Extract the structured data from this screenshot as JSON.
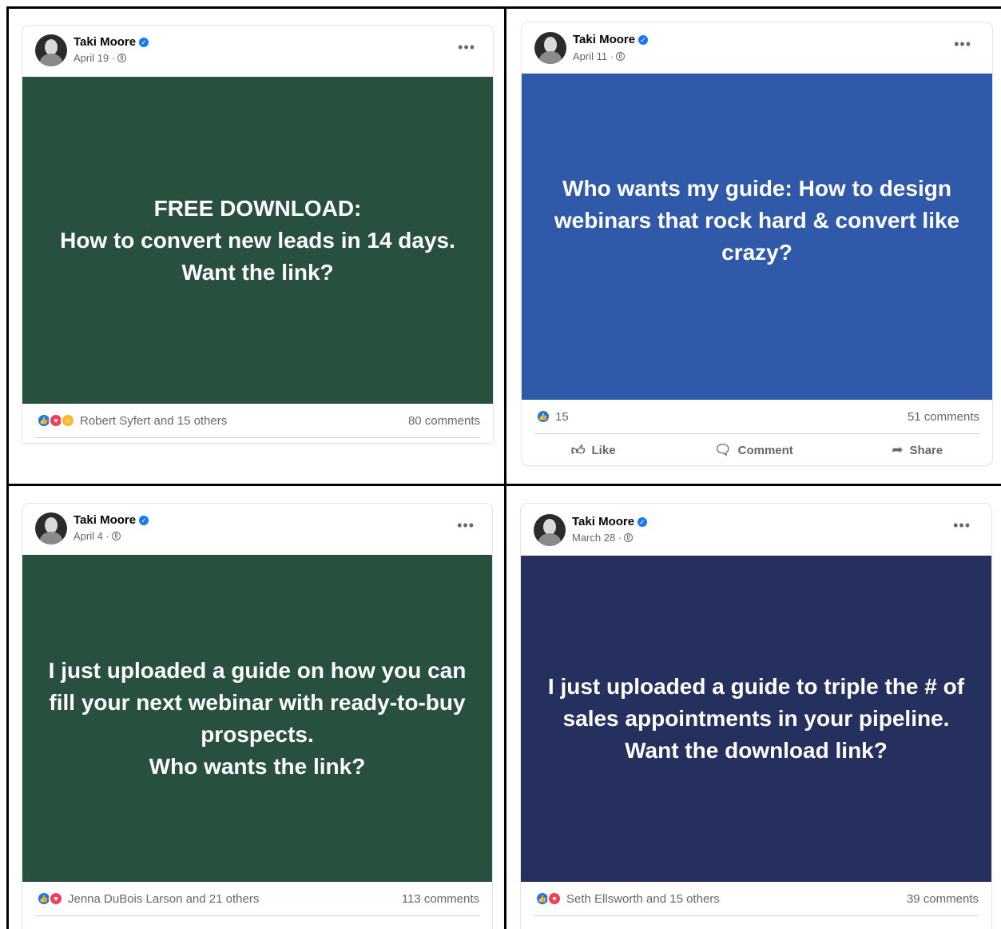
{
  "posts": [
    {
      "author": "Taki Moore",
      "date": "April 19 ·",
      "banner_text": "FREE DOWNLOAD:\nHow to convert new leads in 14 days.\nWant the link?",
      "banner_color": "#27503f",
      "reactions_summary": "Robert Syfert and 15 others",
      "comments": "80 comments",
      "reaction_icons": [
        "like-icon",
        "love-icon",
        "care-icon"
      ]
    },
    {
      "author": "Taki Moore",
      "date": "April 11 ·",
      "banner_text": "Who wants my guide: How to design webinars that rock hard & convert like crazy?",
      "banner_color": "#3059aa",
      "reactions_summary": "15",
      "comments": "51 comments",
      "reaction_icons": [
        "like-icon"
      ],
      "actions": {
        "like": "Like",
        "comment": "Comment",
        "share": "Share"
      }
    },
    {
      "author": "Taki Moore",
      "date": "April 4 ·",
      "banner_text": "I just uploaded a guide on how you can fill your next webinar with ready-to-buy prospects.\nWho wants the link?",
      "banner_color": "#27503f",
      "reactions_summary": "Jenna DuBois Larson and 21 others",
      "comments": "113 comments",
      "reaction_icons": [
        "like-icon",
        "love-icon"
      ]
    },
    {
      "author": "Taki Moore",
      "date": "March 28 ·",
      "banner_text": "I just uploaded a guide to triple the # of sales appointments in your pipeline.\nWant the download link?",
      "banner_color": "#26305e",
      "reactions_summary": "Seth Ellsworth and 15 others",
      "comments": "39 comments",
      "reaction_icons": [
        "like-icon",
        "love-icon"
      ]
    }
  ],
  "colors": {
    "like": "#1877f2",
    "love": "#f33e58",
    "care": "#f7b928",
    "verified": "#1877f2"
  }
}
